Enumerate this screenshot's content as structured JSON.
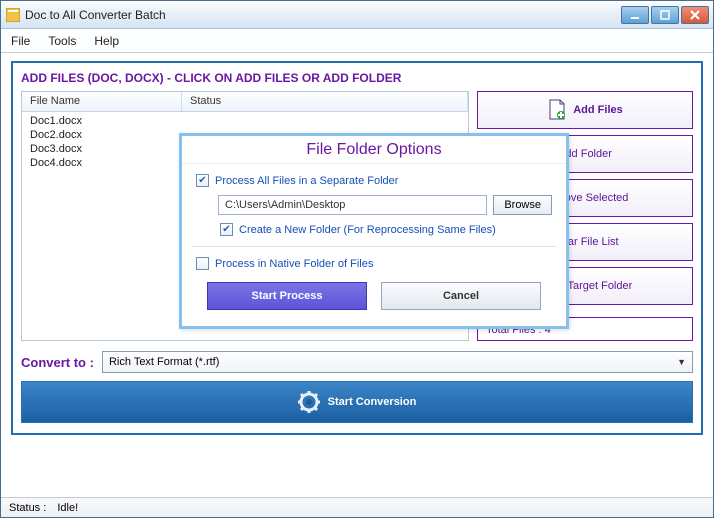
{
  "titlebar": {
    "title": "Doc to All Converter Batch"
  },
  "menu": {
    "file": "File",
    "tools": "Tools",
    "help": "Help"
  },
  "addfiles_header": "ADD FILES (DOC, DOCX) - CLICK ON ADD FILES OR ADD FOLDER",
  "table": {
    "col_filename": "File Name",
    "col_status": "Status",
    "rows": [
      {
        "name": "Doc1.docx"
      },
      {
        "name": "Doc2.docx"
      },
      {
        "name": "Doc3.docx"
      },
      {
        "name": "Doc4.docx"
      }
    ]
  },
  "sidebar": {
    "add_files": "Add Files",
    "add_folder": "Add Folder",
    "remove_selected": "Remove Selected",
    "clear_list": "Clear File List",
    "open_target": "Open Target Folder"
  },
  "total_files": "Total Files : 4",
  "convert_label": "Convert to :",
  "convert_selected": "Rich Text Format (*.rtf)",
  "start_conversion": "Start Conversion",
  "status_label": "Status :",
  "status_value": "Idle!",
  "dialog": {
    "title": "File Folder Options",
    "opt_process_separate": "Process All Files in a Separate Folder",
    "path": "C:\\Users\\Admin\\Desktop",
    "browse": "Browse",
    "opt_create_new": "Create a New Folder (For Reprocessing Same Files)",
    "opt_native": "Process in Native Folder of Files",
    "start": "Start Process",
    "cancel": "Cancel"
  }
}
